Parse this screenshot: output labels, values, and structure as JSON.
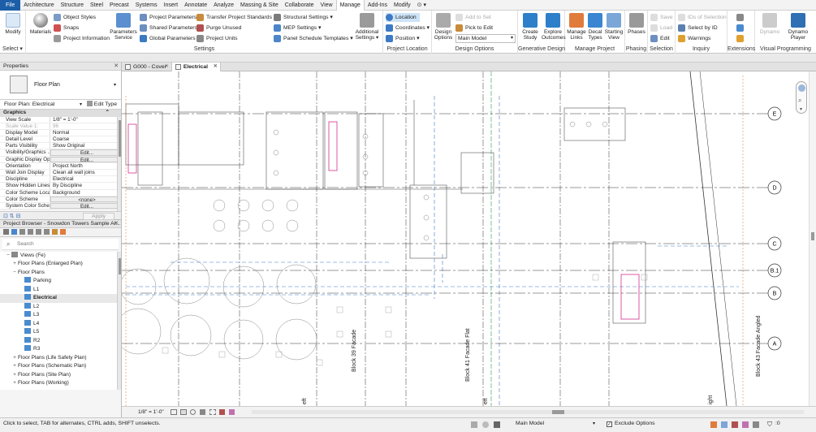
{
  "menu": {
    "tabs": [
      "File",
      "Architecture",
      "Structure",
      "Steel",
      "Precast",
      "Systems",
      "Insert",
      "Annotate",
      "Analyze",
      "Massing & Site",
      "Collaborate",
      "View",
      "Manage",
      "Add-Ins",
      "Modify"
    ],
    "active": "Manage"
  },
  "ribbon": {
    "select": {
      "modify": "Modify",
      "title": "Select ▾"
    },
    "settings": {
      "materials": "Materials",
      "object_styles": "Object Styles",
      "snaps": "Snaps",
      "project_information": "Project Information",
      "project_parameters": "Project Parameters",
      "shared_parameters": "Shared Parameters",
      "global_parameters": "Global Parameters",
      "parameters_service": "Parameters Service",
      "transfer_standards": "Transfer Project Standards",
      "purge_unused": "Purge Unused",
      "project_units": "Project Units",
      "structural_settings": "Structural Settings ▾",
      "mep_settings": "MEP Settings ▾",
      "panel_schedule": "Panel Schedule Templates ▾",
      "additional_settings": "Additional Settings ▾",
      "title": "Settings"
    },
    "location": {
      "location": "Location",
      "coordinates": "Coordinates ▾",
      "position": "Position ▾",
      "title": "Project Location"
    },
    "design": {
      "design_options": "Design Options",
      "add_to_set": "Add to Set",
      "pick_to_edit": "Pick to Edit",
      "main_model": "Main Model",
      "title": "Design Options"
    },
    "generative": {
      "create_study": "Create Study",
      "explore_outcomes": "Explore Outcomes",
      "title": "Generative Design"
    },
    "manage_project": {
      "manage_links": "Manage Links",
      "decal_types": "Decal Types",
      "starting_view": "Starting View",
      "title": "Manage Project"
    },
    "phasing": {
      "phases": "Phases",
      "title": "Phasing"
    },
    "selection": {
      "save": "Save",
      "load": "Load",
      "edit": "Edit",
      "title": "Selection"
    },
    "inquiry": {
      "ids": "IDs of Selection",
      "select_by_id": "Select by ID",
      "warnings": "Warnings",
      "title": "Inquiry"
    },
    "extensions": {
      "title": "Extensions"
    },
    "visual": {
      "dynamo": "Dynamo",
      "dynamo_player": "Dynamo Player",
      "title": "Visual Programming"
    }
  },
  "properties": {
    "header": "Properties",
    "type_name": "Floor Plan",
    "instance": "Floor Plan: Electrical",
    "edit_type": "Edit Type",
    "group": "Graphics",
    "rows": [
      {
        "k": "View Scale",
        "v": "1/8\" = 1'-0\""
      },
      {
        "k": "Scale Value  1:",
        "v": "96",
        "dim": true
      },
      {
        "k": "Display Model",
        "v": "Normal"
      },
      {
        "k": "Detail Level",
        "v": "Coarse"
      },
      {
        "k": "Parts Visibility",
        "v": "Show Original"
      },
      {
        "k": "Visibility/Graphics ...",
        "v": "Edit...",
        "btn": true
      },
      {
        "k": "Graphic Display Op...",
        "v": "Edit...",
        "btn": true
      },
      {
        "k": "Orientation",
        "v": "Project North"
      },
      {
        "k": "Wall Join Display",
        "v": "Clean all wall joins"
      },
      {
        "k": "Discipline",
        "v": "Electrical"
      },
      {
        "k": "Show Hidden Lines",
        "v": "By Discipline"
      },
      {
        "k": "Color Scheme Loca...",
        "v": "Background"
      },
      {
        "k": "Color Scheme",
        "v": "<none>",
        "btn": true
      },
      {
        "k": "System Color Sche...",
        "v": "Edit...",
        "btn": true
      }
    ],
    "apply": "Apply"
  },
  "browser": {
    "header": "Project Browser - Snowdon Towers Sample Ar...",
    "search_placeholder": "Search",
    "nodes": [
      {
        "label": "Views (Fe)",
        "level": 0,
        "exp": "−"
      },
      {
        "label": "Floor Plans (Enlarged Plan)",
        "level": 1,
        "exp": "+"
      },
      {
        "label": "Floor Plans",
        "level": 1,
        "exp": "−"
      },
      {
        "label": "Parking",
        "level": 2,
        "view": true
      },
      {
        "label": "L1",
        "level": 2,
        "view": true
      },
      {
        "label": "Electrical",
        "level": 2,
        "view": true,
        "bold": true
      },
      {
        "label": "L2",
        "level": 2,
        "view": true
      },
      {
        "label": "L3",
        "level": 2,
        "view": true
      },
      {
        "label": "L4",
        "level": 2,
        "view": true
      },
      {
        "label": "L5",
        "level": 2,
        "view": true
      },
      {
        "label": "R2",
        "level": 2,
        "view": true
      },
      {
        "label": "R3",
        "level": 2,
        "view": true
      },
      {
        "label": "Floor Plans (Life Safety Plan)",
        "level": 1,
        "exp": "+"
      },
      {
        "label": "Floor Plans (Schematic Plan)",
        "level": 1,
        "exp": "+"
      },
      {
        "label": "Floor Plans (Site Plan)",
        "level": 1,
        "exp": "+"
      },
      {
        "label": "Floor Plans (Working)",
        "level": 1,
        "exp": "+"
      }
    ]
  },
  "doc_tabs": [
    {
      "label": "G000 - Cover",
      "active": false
    },
    {
      "label": "Electrical",
      "active": true
    }
  ],
  "grids": [
    {
      "label": "E"
    },
    {
      "label": "D"
    },
    {
      "label": "C"
    },
    {
      "label": "B.1"
    },
    {
      "label": "B"
    },
    {
      "label": "A"
    }
  ],
  "drawing_labels": {
    "block39": "Block 39 Facade",
    "block41": "Block 41 Facade Flat",
    "block43": "Block 43 Facade Angled",
    "eft1": "eft",
    "eft2": "eft",
    "ight": "ight"
  },
  "view_bar": {
    "scale": "1/8\" = 1'-0\""
  },
  "status": {
    "hint": "Click to select, TAB for alternates, CTRL adds, SHIFT unselects.",
    "model": "Main Model",
    "exclude": "Exclude Options",
    "filter_count": ":0"
  }
}
